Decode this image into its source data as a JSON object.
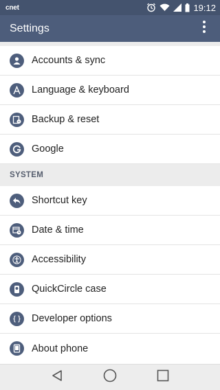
{
  "status_bar": {
    "carrier": "cnet",
    "time": "19:12",
    "icons": [
      "alarm-icon",
      "wifi-icon",
      "signal-icon",
      "battery-icon"
    ]
  },
  "action_bar": {
    "title": "Settings",
    "menu_icon": "overflow-menu-icon"
  },
  "colors": {
    "action_bar": "#4d5d7b",
    "status_bar": "#44536e",
    "icon_circle": "#4e5e7c",
    "section_bg": "#ececec"
  },
  "general_items": [
    {
      "label": "Accounts & sync",
      "icon": "account-icon"
    },
    {
      "label": "Language & keyboard",
      "icon": "language-icon"
    },
    {
      "label": "Backup & reset",
      "icon": "backup-icon"
    },
    {
      "label": "Google",
      "icon": "google-icon"
    }
  ],
  "system_section": {
    "header": "SYSTEM",
    "items": [
      {
        "label": "Shortcut key",
        "icon": "shortcut-icon"
      },
      {
        "label": "Date & time",
        "icon": "calendar-clock-icon"
      },
      {
        "label": "Accessibility",
        "icon": "accessibility-icon"
      },
      {
        "label": "QuickCircle case",
        "icon": "quickcircle-icon"
      },
      {
        "label": "Developer options",
        "icon": "code-braces-icon"
      },
      {
        "label": "About phone",
        "icon": "phone-icon"
      }
    ]
  },
  "nav_bar": {
    "icons": [
      "back-icon",
      "home-icon",
      "recents-icon"
    ]
  }
}
